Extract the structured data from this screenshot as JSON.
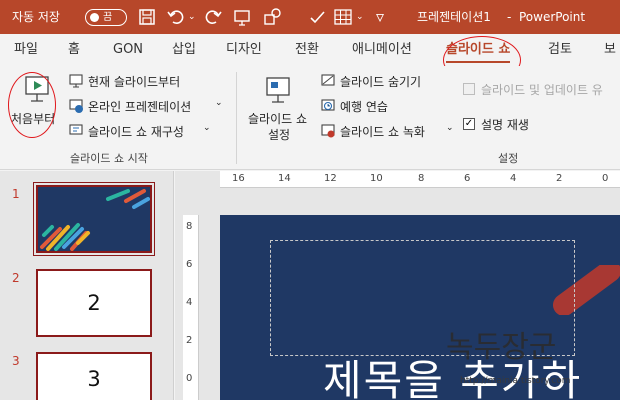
{
  "titlebar": {
    "autosave_label": "자동 저장",
    "autosave_state": "끔",
    "doc_title": "프레젠테이션1",
    "separator": "-",
    "app_name": "PowerPoint",
    "bg_color": "#b7472a"
  },
  "tabs": [
    {
      "label": "파일"
    },
    {
      "label": "홈"
    },
    {
      "label": "GON"
    },
    {
      "label": "삽입"
    },
    {
      "label": "디자인"
    },
    {
      "label": "전환"
    },
    {
      "label": "애니메이션"
    },
    {
      "label": "슬라이드 쇼",
      "active": true
    },
    {
      "label": "검토"
    },
    {
      "label": "보"
    }
  ],
  "ribbon": {
    "from_beginning": "처음부터",
    "from_current": "현재 슬라이드부터",
    "present_online": "온라인 프레젠테이션",
    "custom_show": "슬라이드 쇼 재구성",
    "group_start": "슬라이드 쇼 시작",
    "setup_line1": "슬라이드 쇼",
    "setup_line2": "설정",
    "hide_slide": "슬라이드 숨기기",
    "rehearse": "예행 연습",
    "record": "슬라이드 쇼 녹화",
    "play_narrations": "슬라이드 및 업데이트 유",
    "show_media_controls": "설명 재생",
    "group_setup": "설정",
    "show_media_checked": true,
    "play_narrations_checked": false
  },
  "slides": [
    {
      "number": "1",
      "content": ""
    },
    {
      "number": "2",
      "content": "2"
    },
    {
      "number": "3",
      "content": "3"
    }
  ],
  "ruler": {
    "h_ticks": [
      "16",
      "14",
      "12",
      "10",
      "8",
      "6",
      "4",
      "2",
      "0"
    ],
    "v_ticks": [
      "8",
      "6",
      "4",
      "2",
      "0"
    ]
  },
  "slide": {
    "title_text": "제목을 추가하"
  },
  "watermark": {
    "text": "녹두장군",
    "url": "http://mainia.tistory.com"
  }
}
